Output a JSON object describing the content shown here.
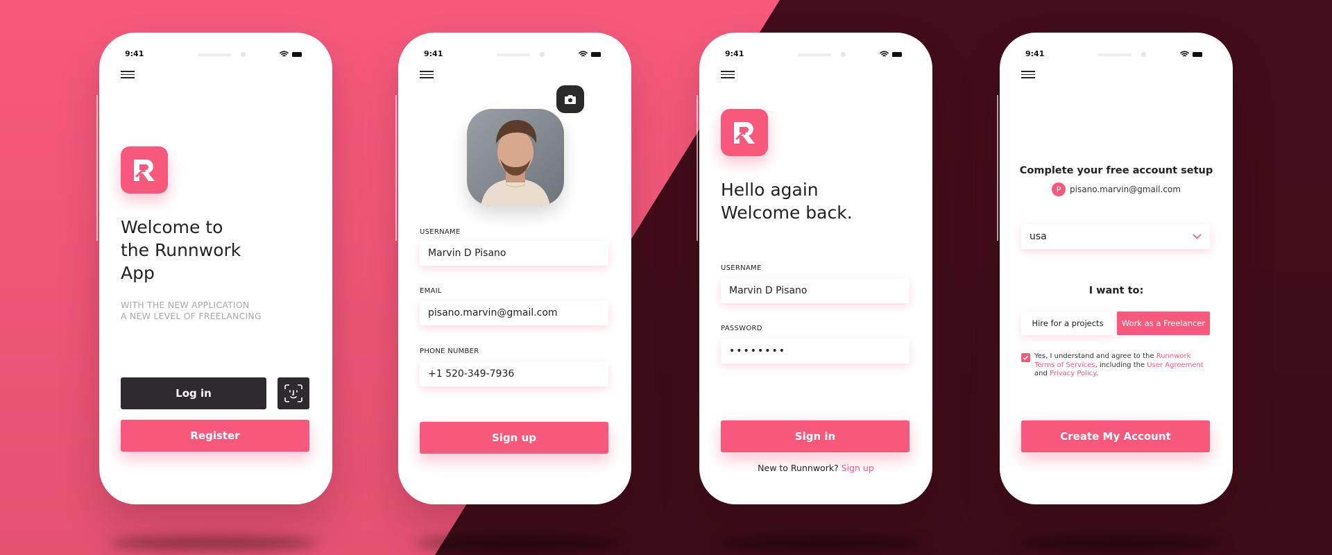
{
  "colors": {
    "accent": "#F7597C",
    "dark": "#420D1A",
    "button_dark": "#2E2A2D"
  },
  "status": {
    "time": "9:41"
  },
  "screen1": {
    "title_line1": "Welcome to",
    "title_line2": "the Runnwork",
    "title_line3": "App",
    "subtitle_line1": "WITH THE NEW APPLICATION",
    "subtitle_line2": "A NEW LEVEL OF FREELANCING",
    "login_label": "Log in",
    "register_label": "Register"
  },
  "screen2": {
    "username_label": "USERNAME",
    "username_value": "Marvin D Pisano",
    "email_label": "EMAIL",
    "email_value": "pisano.marvin@gmail.com",
    "phone_label": "PHONE NUMBER",
    "phone_value": "+1 520-349-7936",
    "signup_label": "Sign up"
  },
  "screen3": {
    "title_line1": "Hello again",
    "title_line2": "Welcome back.",
    "username_label": "USERNAME",
    "username_value": "Marvin D Pisano",
    "password_label": "PASSWORD",
    "password_value": "••••••••",
    "signin_label": "Sign in",
    "new_prompt": "New to Runnwork?",
    "signup_link": "Sign up"
  },
  "screen4": {
    "title": "Complete your free account setup",
    "avatar_letter": "P",
    "email": "pisano.marvin@gmail.com",
    "country_value": "usa",
    "want_label": "I want to:",
    "option_hire": "Hire for a projects",
    "option_freelancer": "Work as a Freelancer",
    "agree_1": "Yes, I understand and agree to the ",
    "agree_link1": "Runnwork Terms of Services",
    "agree_2": ", including the ",
    "agree_link2": "User Agreement",
    "agree_3": " and ",
    "agree_link3": "Privacy Policy",
    "agree_4": ".",
    "create_label": "Create My Account"
  }
}
